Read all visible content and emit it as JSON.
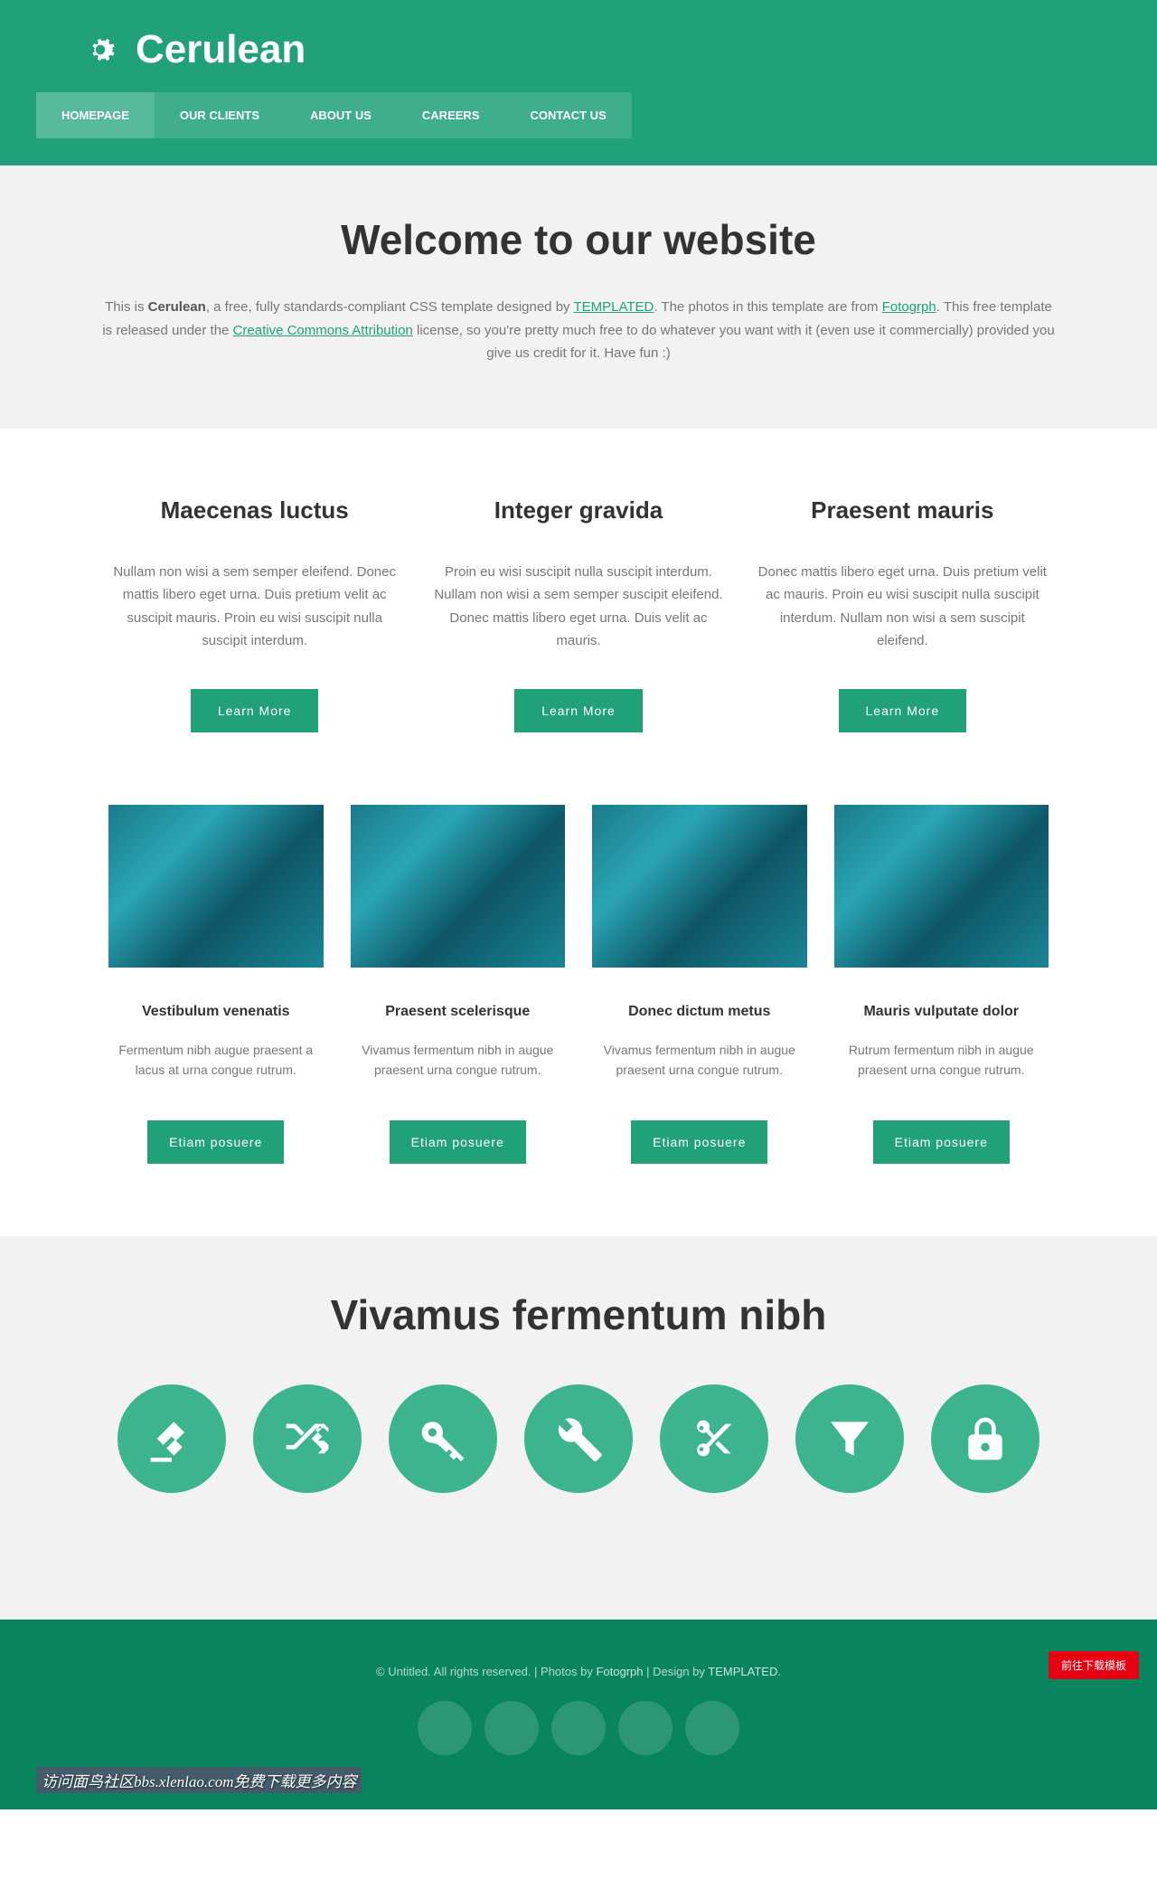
{
  "header": {
    "logo": "Cerulean",
    "nav": [
      "HOMEPAGE",
      "OUR CLIENTS",
      "ABOUT US",
      "CAREERS",
      "CONTACT US"
    ]
  },
  "banner": {
    "title": "Welcome to our website",
    "text_prefix": "This is ",
    "brand": "Cerulean",
    "text_mid1": ", a free, fully standards-compliant CSS template designed by ",
    "link1": "TEMPLATED",
    "text_mid2": ". The photos in this template are from ",
    "link2": "Fotogrph",
    "text_mid3": ". This free template is released under the ",
    "link3": "Creative Commons Attribution",
    "text_end": " license, so you're pretty much free to do whatever you want with it (even use it commercially) provided you give us credit for it. Have fun :)"
  },
  "columns": [
    {
      "title": "Maecenas luctus",
      "body": "Nullam non wisi a sem semper eleifend. Donec mattis libero eget urna. Duis pretium velit ac suscipit mauris. Proin eu wisi suscipit nulla suscipit interdum.",
      "btn": "Learn More"
    },
    {
      "title": "Integer gravida",
      "body": "Proin eu wisi suscipit nulla suscipit interdum. Nullam non wisi a sem semper suscipit eleifend. Donec mattis libero eget urna. Duis velit ac mauris.",
      "btn": "Learn More"
    },
    {
      "title": "Praesent mauris",
      "body": "Donec mattis libero eget urna. Duis pretium velit ac mauris. Proin eu wisi suscipit nulla suscipit interdum. Nullam non wisi a sem suscipit eleifend.",
      "btn": "Learn More"
    }
  ],
  "portfolio": [
    {
      "title": "Vestibulum venenatis",
      "body": "Fermentum nibh augue praesent a lacus at urna congue rutrum.",
      "btn": "Etiam posuere"
    },
    {
      "title": "Praesent scelerisque",
      "body": "Vivamus fermentum nibh in augue praesent urna congue rutrum.",
      "btn": "Etiam posuere"
    },
    {
      "title": "Donec dictum metus",
      "body": "Vivamus fermentum nibh in augue praesent urna congue rutrum.",
      "btn": "Etiam posuere"
    },
    {
      "title": "Mauris vulputate dolor",
      "body": "Rutrum fermentum nibh in augue praesent urna congue rutrum.",
      "btn": "Etiam posuere"
    }
  ],
  "icon_section": {
    "title": "Vivamus fermentum nibh"
  },
  "footer": {
    "copy_prefix": "© Untitled. All rights reserved. | Photos by ",
    "link1": "Fotogrph",
    "copy_mid": " | Design by ",
    "link2": "TEMPLATED",
    "copy_end": ".",
    "red_button": "前往下载模板",
    "watermark": "访问面鸟社区bbs.xlenlao.com免费下载更多内容"
  }
}
